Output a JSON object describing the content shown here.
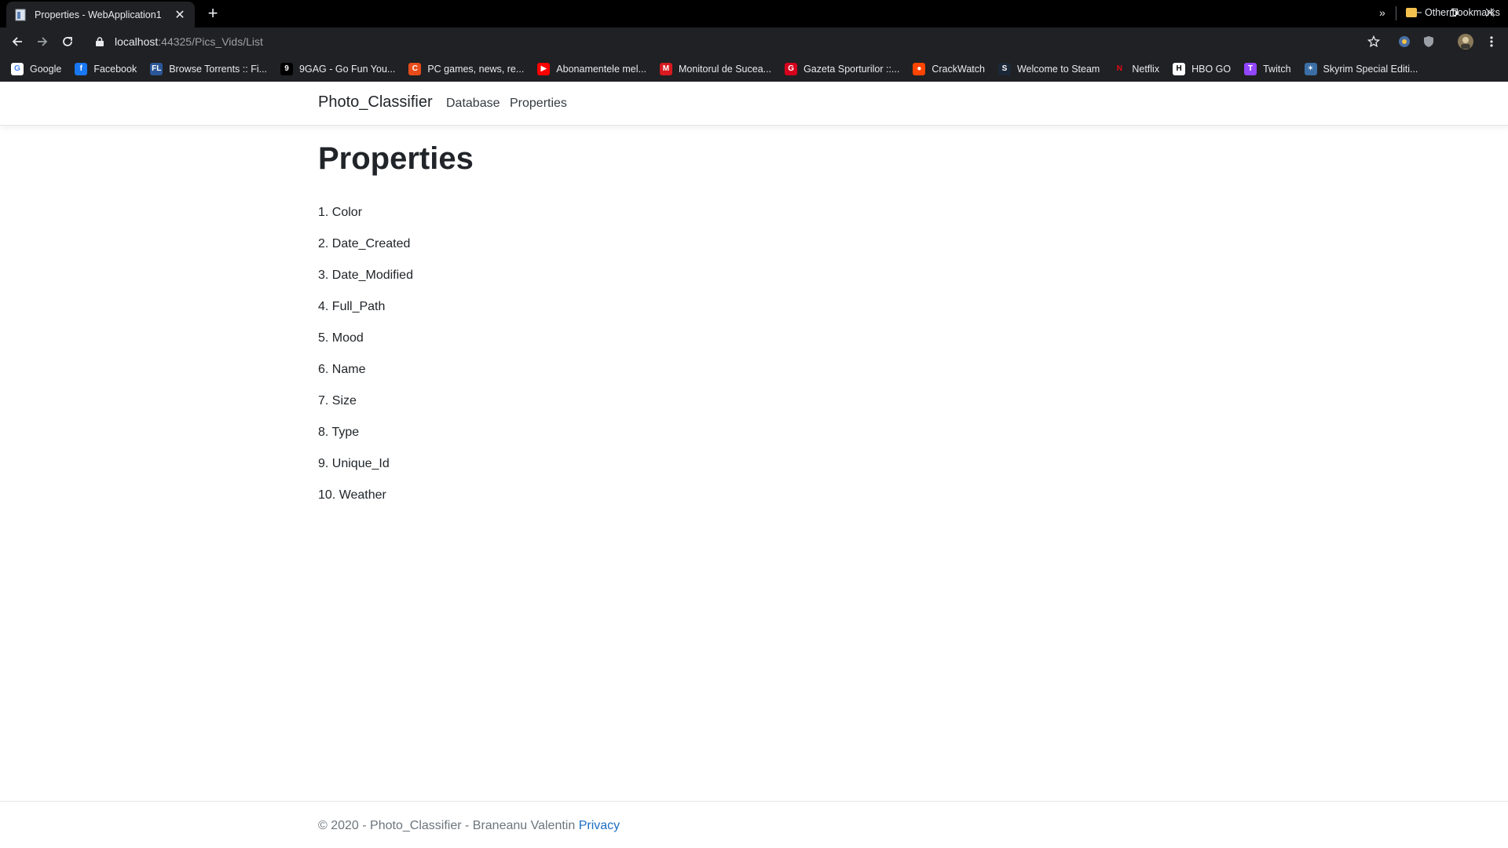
{
  "browser": {
    "tab": {
      "title": "Properties - WebApplication1"
    },
    "address": {
      "host": "localhost",
      "rest": ":44325/Pics_Vids/List"
    },
    "bookmarks": [
      {
        "label": "Google",
        "icon": "google-icon",
        "color": "#ffffff",
        "glyph": "G",
        "fg": "#4285f4"
      },
      {
        "label": "Facebook",
        "icon": "facebook-icon",
        "color": "#1877f2",
        "glyph": "f",
        "fg": "#ffffff"
      },
      {
        "label": "Browse Torrents :: Fi...",
        "icon": "filelist-icon",
        "color": "#2b5797",
        "glyph": "FL",
        "fg": "#ffffff"
      },
      {
        "label": "9GAG - Go Fun You...",
        "icon": "9gag-icon",
        "color": "#000000",
        "glyph": "9",
        "fg": "#ffffff"
      },
      {
        "label": "PC games, news, re...",
        "icon": "pcgames-icon",
        "color": "#e84c1a",
        "glyph": "C",
        "fg": "#ffffff"
      },
      {
        "label": "Abonamentele mel...",
        "icon": "youtube-icon",
        "color": "#ff0000",
        "glyph": "▶",
        "fg": "#ffffff"
      },
      {
        "label": "Monitorul de Sucea...",
        "icon": "monitorul-icon",
        "color": "#d71920",
        "glyph": "M",
        "fg": "#ffffff"
      },
      {
        "label": "Gazeta Sporturilor ::...",
        "icon": "gazeta-icon",
        "color": "#d6001c",
        "glyph": "G",
        "fg": "#ffffff"
      },
      {
        "label": "CrackWatch",
        "icon": "reddit-icon",
        "color": "#ff4500",
        "glyph": "●",
        "fg": "#ffffff"
      },
      {
        "label": "Welcome to Steam",
        "icon": "steam-icon",
        "color": "#1b2838",
        "glyph": "S",
        "fg": "#ffffff"
      },
      {
        "label": "Netflix",
        "icon": "netflix-icon",
        "color": "#202124",
        "glyph": "N",
        "fg": "#e50914"
      },
      {
        "label": "HBO GO",
        "icon": "hbo-icon",
        "color": "#ffffff",
        "glyph": "H",
        "fg": "#000000"
      },
      {
        "label": "Twitch",
        "icon": "twitch-icon",
        "color": "#9146ff",
        "glyph": "T",
        "fg": "#ffffff"
      },
      {
        "label": "Skyrim Special Editi...",
        "icon": "skyrim-icon",
        "color": "#3a6ea5",
        "glyph": "✶",
        "fg": "#ffffff"
      }
    ],
    "bookmarks_more": "»",
    "other_bookmarks": "Other bookmarks"
  },
  "site": {
    "brand": "Photo_Classifier",
    "nav": [
      "Database",
      "Properties"
    ],
    "title": "Properties",
    "properties": [
      "1. Color",
      "2. Date_Created",
      "3. Date_Modified",
      "4. Full_Path",
      "5. Mood",
      "6. Name",
      "7. Size",
      "8. Type",
      "9. Unique_Id",
      "10. Weather"
    ],
    "footer": {
      "text": "© 2020 - Photo_Classifier - Braneanu Valentin",
      "link": "Privacy"
    }
  }
}
